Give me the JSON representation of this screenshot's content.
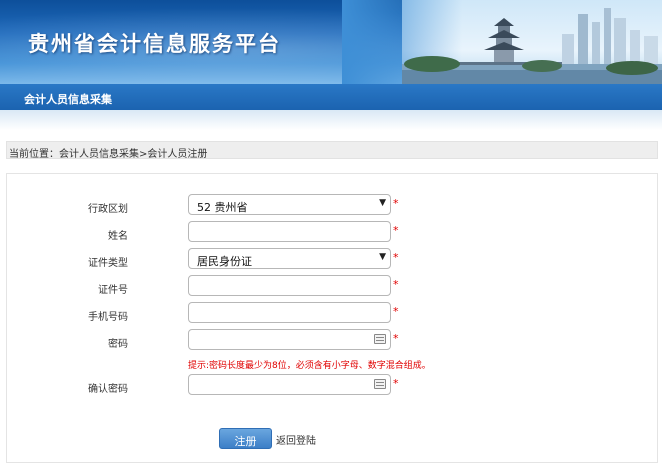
{
  "header": {
    "site_title": "贵州省会计信息服务平台"
  },
  "nav": {
    "items": [
      {
        "label": "会计人员信息采集"
      }
    ]
  },
  "breadcrumb": {
    "text": "当前位置：会计人员信息采集>会计人员注册"
  },
  "form": {
    "region_label": "行政区划",
    "region_value": "52 贵州省",
    "name_label": "姓名",
    "name_value": "",
    "id_type_label": "证件类型",
    "id_type_value": "居民身份证",
    "id_number_label": "证件号",
    "id_number_value": "",
    "phone_label": "手机号码",
    "phone_value": "",
    "password_label": "密码",
    "password_value": "",
    "password_hint": "提示:密码长度最少为8位，必须含有小字母、数字混合组成。",
    "confirm_label": "确认密码",
    "confirm_value": "",
    "required_mark": "*"
  },
  "actions": {
    "register_label": "注册",
    "back_label": "返回登陆"
  },
  "colors": {
    "brand_blue": "#1b63b0",
    "required_red": "#e00000"
  }
}
